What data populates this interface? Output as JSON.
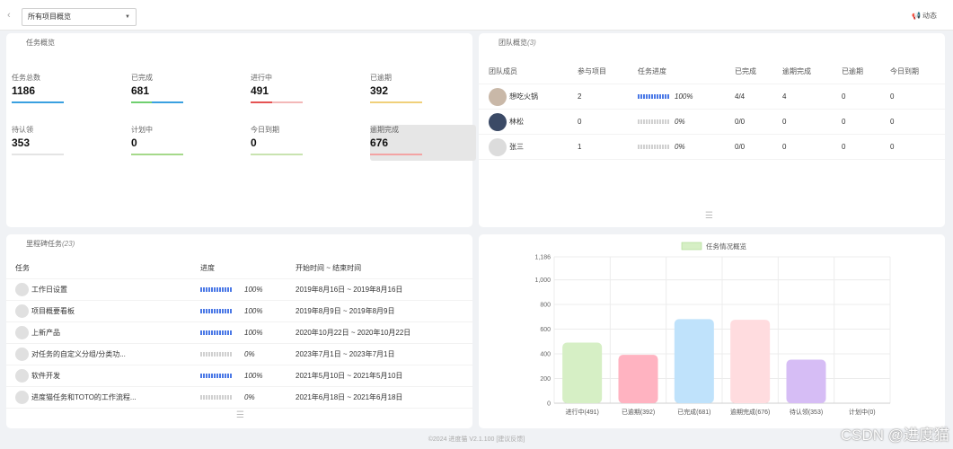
{
  "topbar": {
    "back_icon": "chevron-left-icon",
    "project_select": "所有项目概览",
    "activity": "动态",
    "activity_icon": "megaphone-icon"
  },
  "task_overview": {
    "title": "任务概览",
    "stats": [
      {
        "label": "任务总数",
        "value": "1186",
        "color": "#3aa0e0",
        "fill": 1.0
      },
      {
        "label": "已完成",
        "value": "681",
        "color": "#3aa0e0",
        "fill": 1.0,
        "color2": "#6fcf6f"
      },
      {
        "label": "进行中",
        "value": "491",
        "color": "#e55353",
        "fill": 0.41
      },
      {
        "label": "已逾期",
        "value": "392",
        "color": "#f0d07a",
        "fill": 1.0
      },
      {
        "label": "待认领",
        "value": "353",
        "color": "#e4e4e4",
        "fill": 0
      },
      {
        "label": "计划中",
        "value": "0",
        "color": "#a5d98a",
        "fill": 1.0
      },
      {
        "label": "今日到期",
        "value": "0",
        "color": "#c9e3b0",
        "fill": 1.0
      },
      {
        "label": "逾期完成",
        "value": "676",
        "color": "#f3a3a3",
        "fill": 1.0
      }
    ]
  },
  "team_overview": {
    "title": "团队概览",
    "count": "(3)",
    "headers": [
      "团队成员",
      "参与项目",
      "任务进度",
      "已完成",
      "逾期完成",
      "已逾期",
      "今日到期"
    ],
    "rows": [
      {
        "name": "想吃火锅",
        "projects": "2",
        "progress": 1.0,
        "pct": "100%",
        "done": "4/4",
        "late_done": "4",
        "overdue": "0",
        "today": "0"
      },
      {
        "name": "林松",
        "projects": "0",
        "progress": 0,
        "pct": "0%",
        "done": "0/0",
        "late_done": "0",
        "overdue": "0",
        "today": "0"
      },
      {
        "name": "张三",
        "projects": "1",
        "progress": 0,
        "pct": "0%",
        "done": "0/0",
        "late_done": "0",
        "overdue": "0",
        "today": "0"
      }
    ]
  },
  "milestones": {
    "title": "里程碑任务",
    "count": "(23)",
    "headers": [
      "任务",
      "进度",
      "开始时间 ~ 结束时间"
    ],
    "rows": [
      {
        "task": "工作日设置",
        "progress": 1.0,
        "pct": "100%",
        "range": "2019年8月16日 ~ 2019年8月16日"
      },
      {
        "task": "项目概要看板",
        "progress": 1.0,
        "pct": "100%",
        "range": "2019年8月9日 ~ 2019年8月9日"
      },
      {
        "task": "上新产品",
        "progress": 1.0,
        "pct": "100%",
        "range": "2020年10月22日 ~ 2020年10月22日"
      },
      {
        "task": "对任务的自定义分组/分类功...",
        "progress": 0,
        "pct": "0%",
        "range": "2023年7月1日 ~ 2023年7月1日"
      },
      {
        "task": "软件开发",
        "progress": 1.0,
        "pct": "100%",
        "range": "2021年5月10日 ~ 2021年5月10日"
      },
      {
        "task": "进度猫任务和TOTO的工作流程...",
        "progress": 0,
        "pct": "0%",
        "range": "2021年6月18日 ~ 2021年6月18日"
      }
    ]
  },
  "chart_data": {
    "type": "bar",
    "legend": "任务情况概览",
    "categories": [
      "进行中(491)",
      "已逾期(392)",
      "已完成(681)",
      "逾期完成(676)",
      "待认领(353)",
      "计划中(0)"
    ],
    "values": [
      491,
      392,
      681,
      676,
      353,
      0
    ],
    "colors": [
      "#d6efc5",
      "#ffb3c1",
      "#bfe2fb",
      "#ffdcdf",
      "#d6bdf5",
      "#e6e6e6"
    ],
    "yticks": [
      "0",
      "200",
      "400",
      "600",
      "800",
      "1,000",
      "1,186"
    ],
    "ylim": [
      0,
      1186
    ],
    "grid": true,
    "legend_position": "top"
  },
  "footer": "©2024 进度猫 V2.1.100  [建议反馈]",
  "watermark": "CSDN @进度猫"
}
